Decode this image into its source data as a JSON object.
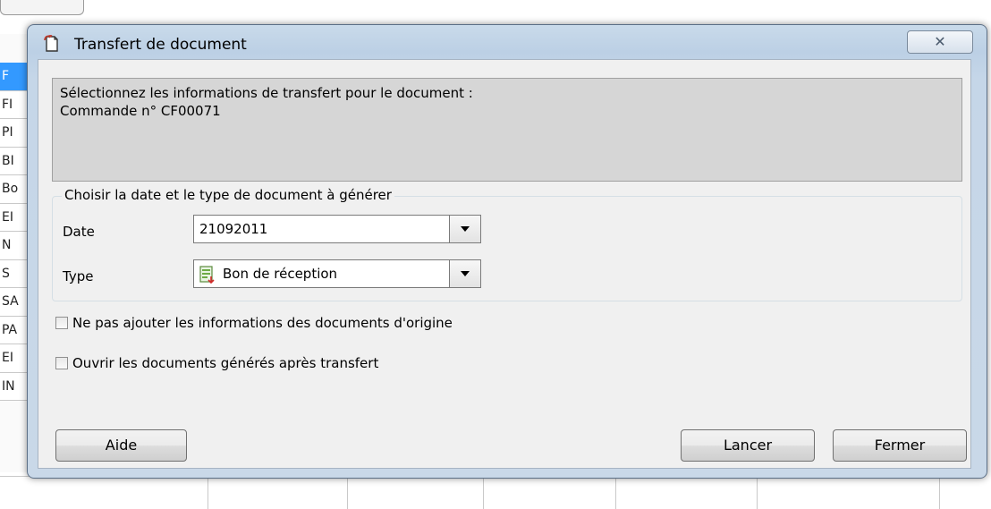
{
  "background": {
    "row_labels": [
      "F",
      "FI",
      "PI",
      "BI",
      "Bo",
      "EI",
      "N",
      "S",
      "SA",
      "PA",
      "EI",
      "IN"
    ]
  },
  "dialog": {
    "title": "Transfert de document",
    "close_glyph": "✕",
    "info_line1": "Sélectionnez les informations de transfert pour le document :",
    "info_line2": "Commande n° CF00071",
    "group_title": "Choisir la date et le type de document à générer",
    "date_label": "Date",
    "date_value": "21092011",
    "type_label": "Type",
    "type_value": "Bon de réception",
    "check1_label": "Ne pas ajouter les informations des documents d'origine",
    "check1_checked": false,
    "check2_label": "Ouvrir les documents générés après transfert",
    "check2_checked": false,
    "help_button": "Aide",
    "launch_button": "Lancer",
    "close_button": "Fermer"
  },
  "colors": {
    "selection_row": "#3399ff",
    "window_frame": "#c9daea"
  }
}
